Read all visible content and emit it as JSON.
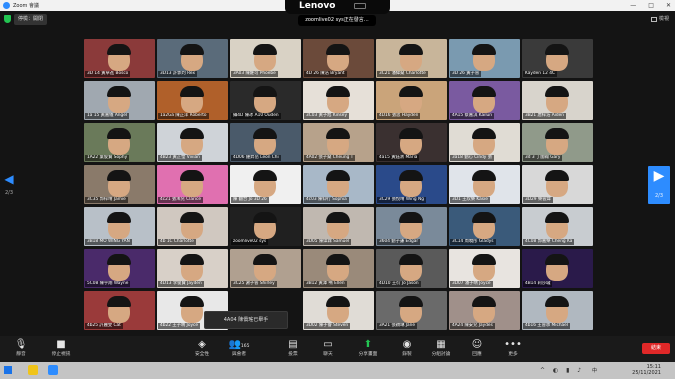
{
  "window": {
    "title": "Zoom 會議",
    "controls": [
      "—",
      "□",
      "✕"
    ]
  },
  "topbar": {
    "chip_label": "停檢：開閉",
    "banner": "zoomlive02  sys正在發言…",
    "view_label": "檢視"
  },
  "nav": {
    "left_arrow": "◀",
    "left_page": "2/3",
    "right_arrow": "▶",
    "right_page": "2/3"
  },
  "participants": [
    "3D 14 黃卓進 Bosco",
    "3D13 許郭灼 Rex",
    "3A03 陳維可 Phoebe",
    "4D 26 陳浩 Bryant",
    "3C21 潘緯燊 Charlotte",
    "3D 26 黃子晉",
    "Kayden 12 4C",
    "1a 15 黃嘉儀 Angel",
    "1a2Ga 陳正洋 Roberto",
    "攝4D 陳冰 A10 Ouden",
    "3C03 黃子旭 Kinsey",
    "4D16 張思 Hayden",
    "4A15 蔡嘉淇 Kailun",
    "3B21 唐梓浩 Aiden",
    "1A22 葉俊賢 Sophy",
    "4B23 黃芷瑩 Vivian",
    "4D06 鍾昇岳 Leon Chi",
    "4A02 張子燊 Cheung T",
    "4a15 黃鈺清 Maria",
    "3a18 劉心 Cindy 張",
    "3d 3 丁國翰 Gary",
    "3C35 郭梓晴 Jamie",
    "4c21 張浠兒 Clarice",
    "陳 翻合 Jo 3D 26",
    "4c03 陳仰行 Sophia",
    "3C29 張悅晴 Wing Ng",
    "3D1 王欣樂 Kasie",
    "3D29 樂晉煒",
    "3B18 MO WING YAN",
    "4b 1C Charlotte",
    "zoomlive02 sys",
    "3D05 陳偉霖 Samuel",
    "3604 劉子謙 Edgar",
    "3C14 周曉彤 Gladys",
    "4C08 郭嘉樂 Cheng Ka",
    "5C08 陳宇翔 Wayne",
    "4D13 李俊賢 Jayden",
    "3C25 謝子晉 Shirley",
    "3B12 黃澤 鳴 Ellen",
    "4D10 王衍 Jo Jason",
    "3D07 潘子晴 Joyce",
    "4B14 莉莎瓏",
    "4b25 許麗雯 Cat",
    "4b22 王子晴 Joyce",
    "",
    "3D02 陳子睿 Steven",
    "3A21 張穎琳 Jane",
    "4A24 陳安兒 Jaydes",
    "4b16 王晉承 Michael"
  ],
  "toast": "4A04 陳僑瑤已舉手",
  "toolbar": {
    "items": [
      {
        "id": "mute",
        "label": "靜音",
        "icon": "microphone-icon"
      },
      {
        "id": "video",
        "label": "停止視訊",
        "icon": "video-camera-icon"
      },
      {
        "id": "security",
        "label": "安全性",
        "icon": "shield-icon"
      },
      {
        "id": "participants",
        "label": "與會者",
        "count": "165",
        "icon": "participants-icon"
      },
      {
        "id": "polls",
        "label": "投票",
        "icon": "poll-icon"
      },
      {
        "id": "chat",
        "label": "聊天",
        "icon": "chat-icon"
      },
      {
        "id": "share",
        "label": "分享畫面",
        "icon": "share-screen-icon"
      },
      {
        "id": "record",
        "label": "錄製",
        "icon": "record-icon"
      },
      {
        "id": "breakout",
        "label": "分組討論",
        "icon": "breakout-icon"
      },
      {
        "id": "reactions",
        "label": "回應",
        "icon": "reaction-icon"
      },
      {
        "id": "more",
        "label": "更多",
        "icon": "more-icon"
      }
    ],
    "end": "結束"
  },
  "taskbar": {
    "time": "15:11",
    "date": "25/11/2021",
    "lang": "中"
  }
}
